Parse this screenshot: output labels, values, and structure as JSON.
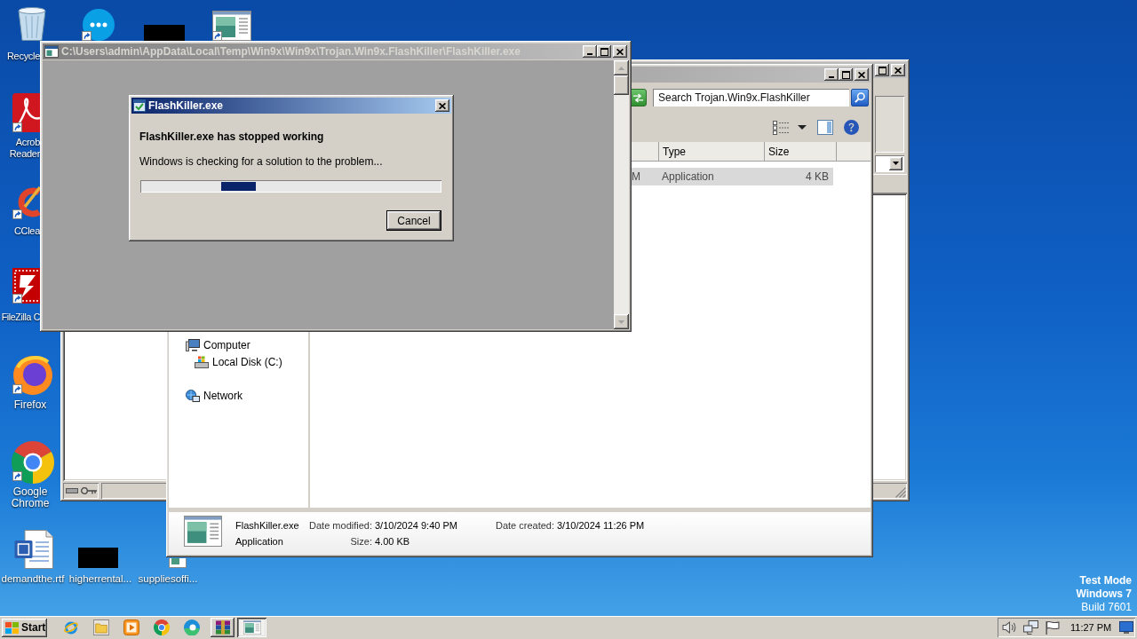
{
  "desktop": {
    "icons": [
      {
        "kind": "bin",
        "label": "Recycle",
        "shortcut": false
      },
      {
        "kind": "chat",
        "shortcut": true
      },
      {
        "kind": "redacted",
        "shortcut": false
      },
      {
        "kind": "thumbnail",
        "shortcut": true
      },
      {
        "kind": "pdf",
        "label": "Acrob Reader",
        "shortcut": true
      },
      {
        "kind": "cleaner",
        "label": "CClea",
        "shortcut": true
      },
      {
        "kind": "ftp",
        "label": "FileZilla C",
        "shortcut": true
      },
      {
        "kind": "fox",
        "label": "Firefox",
        "shortcut": true
      },
      {
        "kind": "wheel",
        "label": "Google Chrome",
        "shortcut": true
      },
      {
        "kind": "doc",
        "label": "demandthe.rtf",
        "shortcut": false
      },
      {
        "kind": "redacted",
        "label": "higherrental...",
        "shortcut": false
      },
      {
        "kind": "file",
        "label": "suppliesoffi...",
        "shortcut": false
      }
    ],
    "system_info": [
      {
        "text": "Test Mode",
        "bold": true
      },
      {
        "text": "Windows 7",
        "bold": true
      },
      {
        "text": "Build 7601",
        "bold": false
      }
    ]
  },
  "background_window": {
    "active": false,
    "title_buttons": [
      {
        "kind": "maximize"
      },
      {
        "kind": "close"
      }
    ]
  },
  "explorer": {
    "active": false,
    "title_buttons": [
      {
        "kind": "minimize"
      },
      {
        "kind": "maximize"
      },
      {
        "kind": "close"
      }
    ],
    "search": {
      "placeholder": "Search Trojan.Win9x.FlashKiller"
    },
    "columns": [
      {
        "label": "Type"
      },
      {
        "label": "Size"
      }
    ],
    "rows": [
      {
        "date_fragment": "M",
        "type": "Application",
        "size": "4 KB",
        "selected": true
      }
    ],
    "nav": [
      {
        "kind": "computer",
        "label": "Computer",
        "children": [
          {
            "kind": "disk",
            "label": "Local Disk (C:)"
          }
        ]
      },
      {
        "kind": "network",
        "label": "Network"
      }
    ],
    "details": {
      "name": "FlashKiller.exe",
      "type": "Application",
      "fields": [
        {
          "label": "Date modified:",
          "value": "3/10/2024 9:40 PM"
        },
        {
          "label": "Date created:",
          "value": "3/10/2024 11:26 PM"
        },
        {
          "label": "Size:",
          "value": "4.00 KB"
        }
      ]
    }
  },
  "console": {
    "active": false,
    "title": "C:\\Users\\admin\\AppData\\Local\\Temp\\Win9x\\Win9x\\Trojan.Win9x.FlashKiller\\FlashKiller.exe",
    "title_buttons": [
      {
        "kind": "minimize"
      },
      {
        "kind": "maximize"
      },
      {
        "kind": "close"
      }
    ]
  },
  "dialog": {
    "active": true,
    "title": "FlashKiller.exe",
    "title_buttons": [
      {
        "kind": "close"
      }
    ],
    "heading": "FlashKiller.exe has stopped working",
    "message": "Windows is checking for a solution to the problem...",
    "progress": {
      "indeterminate": true
    },
    "buttons": [
      {
        "label": "Cancel",
        "default": true
      }
    ]
  },
  "taskbar": {
    "start": {
      "label": "Start"
    },
    "quick_launch": [
      {
        "kind": "globe"
      },
      {
        "kind": "folder"
      },
      {
        "kind": "media"
      },
      {
        "kind": "wheel"
      },
      {
        "kind": "swirl"
      }
    ],
    "buttons": [
      {
        "kind": "archive",
        "selected": false
      },
      {
        "kind": "window",
        "selected": true
      }
    ],
    "tray": [
      {
        "kind": "speaker"
      },
      {
        "kind": "network"
      },
      {
        "kind": "flag"
      }
    ],
    "clock": "11:27 PM"
  }
}
